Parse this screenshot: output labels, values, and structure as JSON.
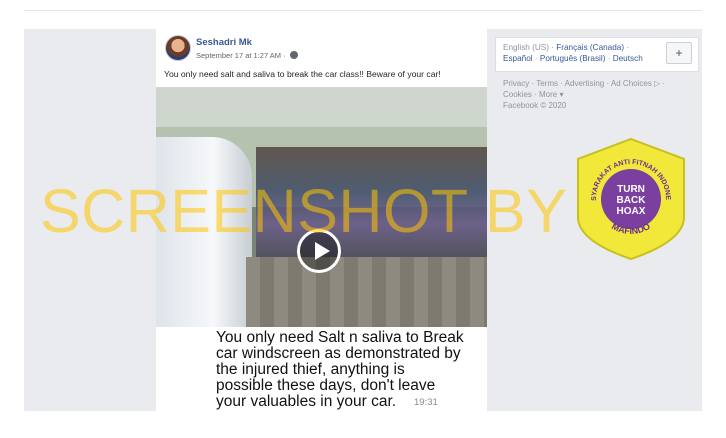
{
  "post": {
    "author": "Seshadri Mk",
    "timestamp": "September 17 at 1:27 AM",
    "privacy_icon": "globe-icon",
    "caption": "You only need salt and saliva to break the car class!! Beware of your car!",
    "video": {
      "overlay_text": [
        "You only need Salt n saliva to Break",
        "car windscreen as demonstrated by",
        "the injured thief, anything is",
        "possible these days,  don't leave",
        "your valuables in your car."
      ],
      "duration": "19:31",
      "play_icon": "play-icon"
    }
  },
  "watermark": "SCREENSHOT BY",
  "languages": {
    "current": "English (US)",
    "links": [
      "Français (Canada)",
      "Español",
      "Português (Brasil)",
      "Deutsch"
    ],
    "add_label": "+"
  },
  "footer": {
    "links": [
      "Privacy",
      "Terms",
      "Advertising",
      "Ad Choices ▷",
      "Cookies",
      "More ▾"
    ],
    "copyright": "Facebook © 2020"
  },
  "badge": {
    "ring_text_top": "MASYARAKAT ANTI FITNAH INDONESIA",
    "ring_text_bottom": "MAFINDO",
    "center_lines": [
      "TURN",
      "BACK",
      "HOAX"
    ],
    "colors": {
      "outer": "#f2e83a",
      "inner": "#7b3fa0"
    }
  }
}
